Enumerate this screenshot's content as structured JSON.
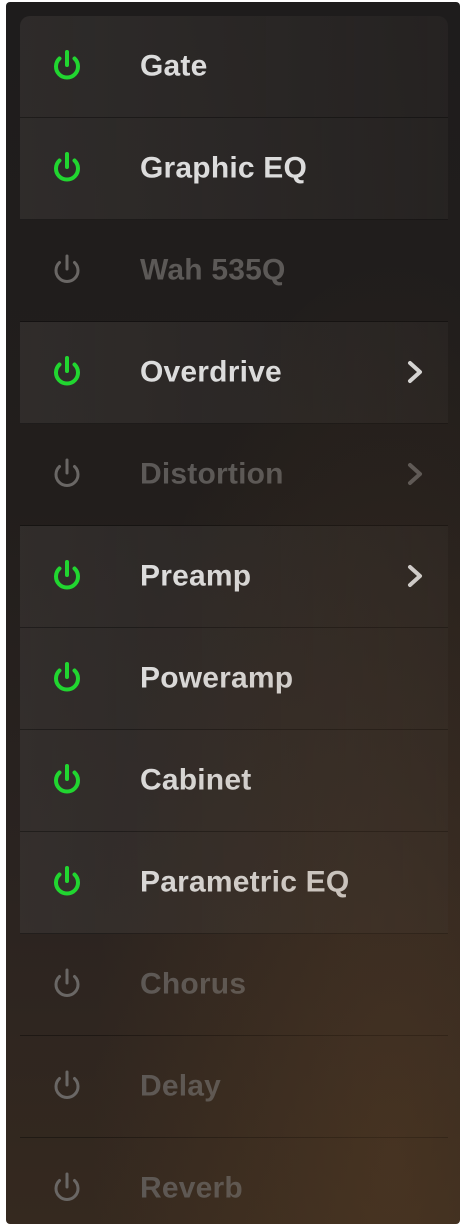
{
  "colors": {
    "power_on": "#21d630",
    "power_off": "#6a6765",
    "label_on": "#dcdcdc",
    "label_off": "#5c5957"
  },
  "modules": [
    {
      "label": "Gate",
      "enabled": true,
      "has_submenu": false,
      "icon": "power-icon"
    },
    {
      "label": "Graphic EQ",
      "enabled": true,
      "has_submenu": false,
      "icon": "power-icon"
    },
    {
      "label": "Wah 535Q",
      "enabled": false,
      "has_submenu": false,
      "icon": "power-icon"
    },
    {
      "label": "Overdrive",
      "enabled": true,
      "has_submenu": true,
      "icon": "power-icon"
    },
    {
      "label": "Distortion",
      "enabled": false,
      "has_submenu": true,
      "icon": "power-icon"
    },
    {
      "label": "Preamp",
      "enabled": true,
      "has_submenu": true,
      "icon": "power-icon"
    },
    {
      "label": "Poweramp",
      "enabled": true,
      "has_submenu": false,
      "icon": "power-icon"
    },
    {
      "label": "Cabinet",
      "enabled": true,
      "has_submenu": false,
      "icon": "power-icon"
    },
    {
      "label": "Parametric EQ",
      "enabled": true,
      "has_submenu": false,
      "icon": "power-icon"
    },
    {
      "label": "Chorus",
      "enabled": false,
      "has_submenu": false,
      "icon": "power-icon"
    },
    {
      "label": "Delay",
      "enabled": false,
      "has_submenu": false,
      "icon": "power-icon"
    },
    {
      "label": "Reverb",
      "enabled": false,
      "has_submenu": false,
      "icon": "power-icon"
    }
  ]
}
